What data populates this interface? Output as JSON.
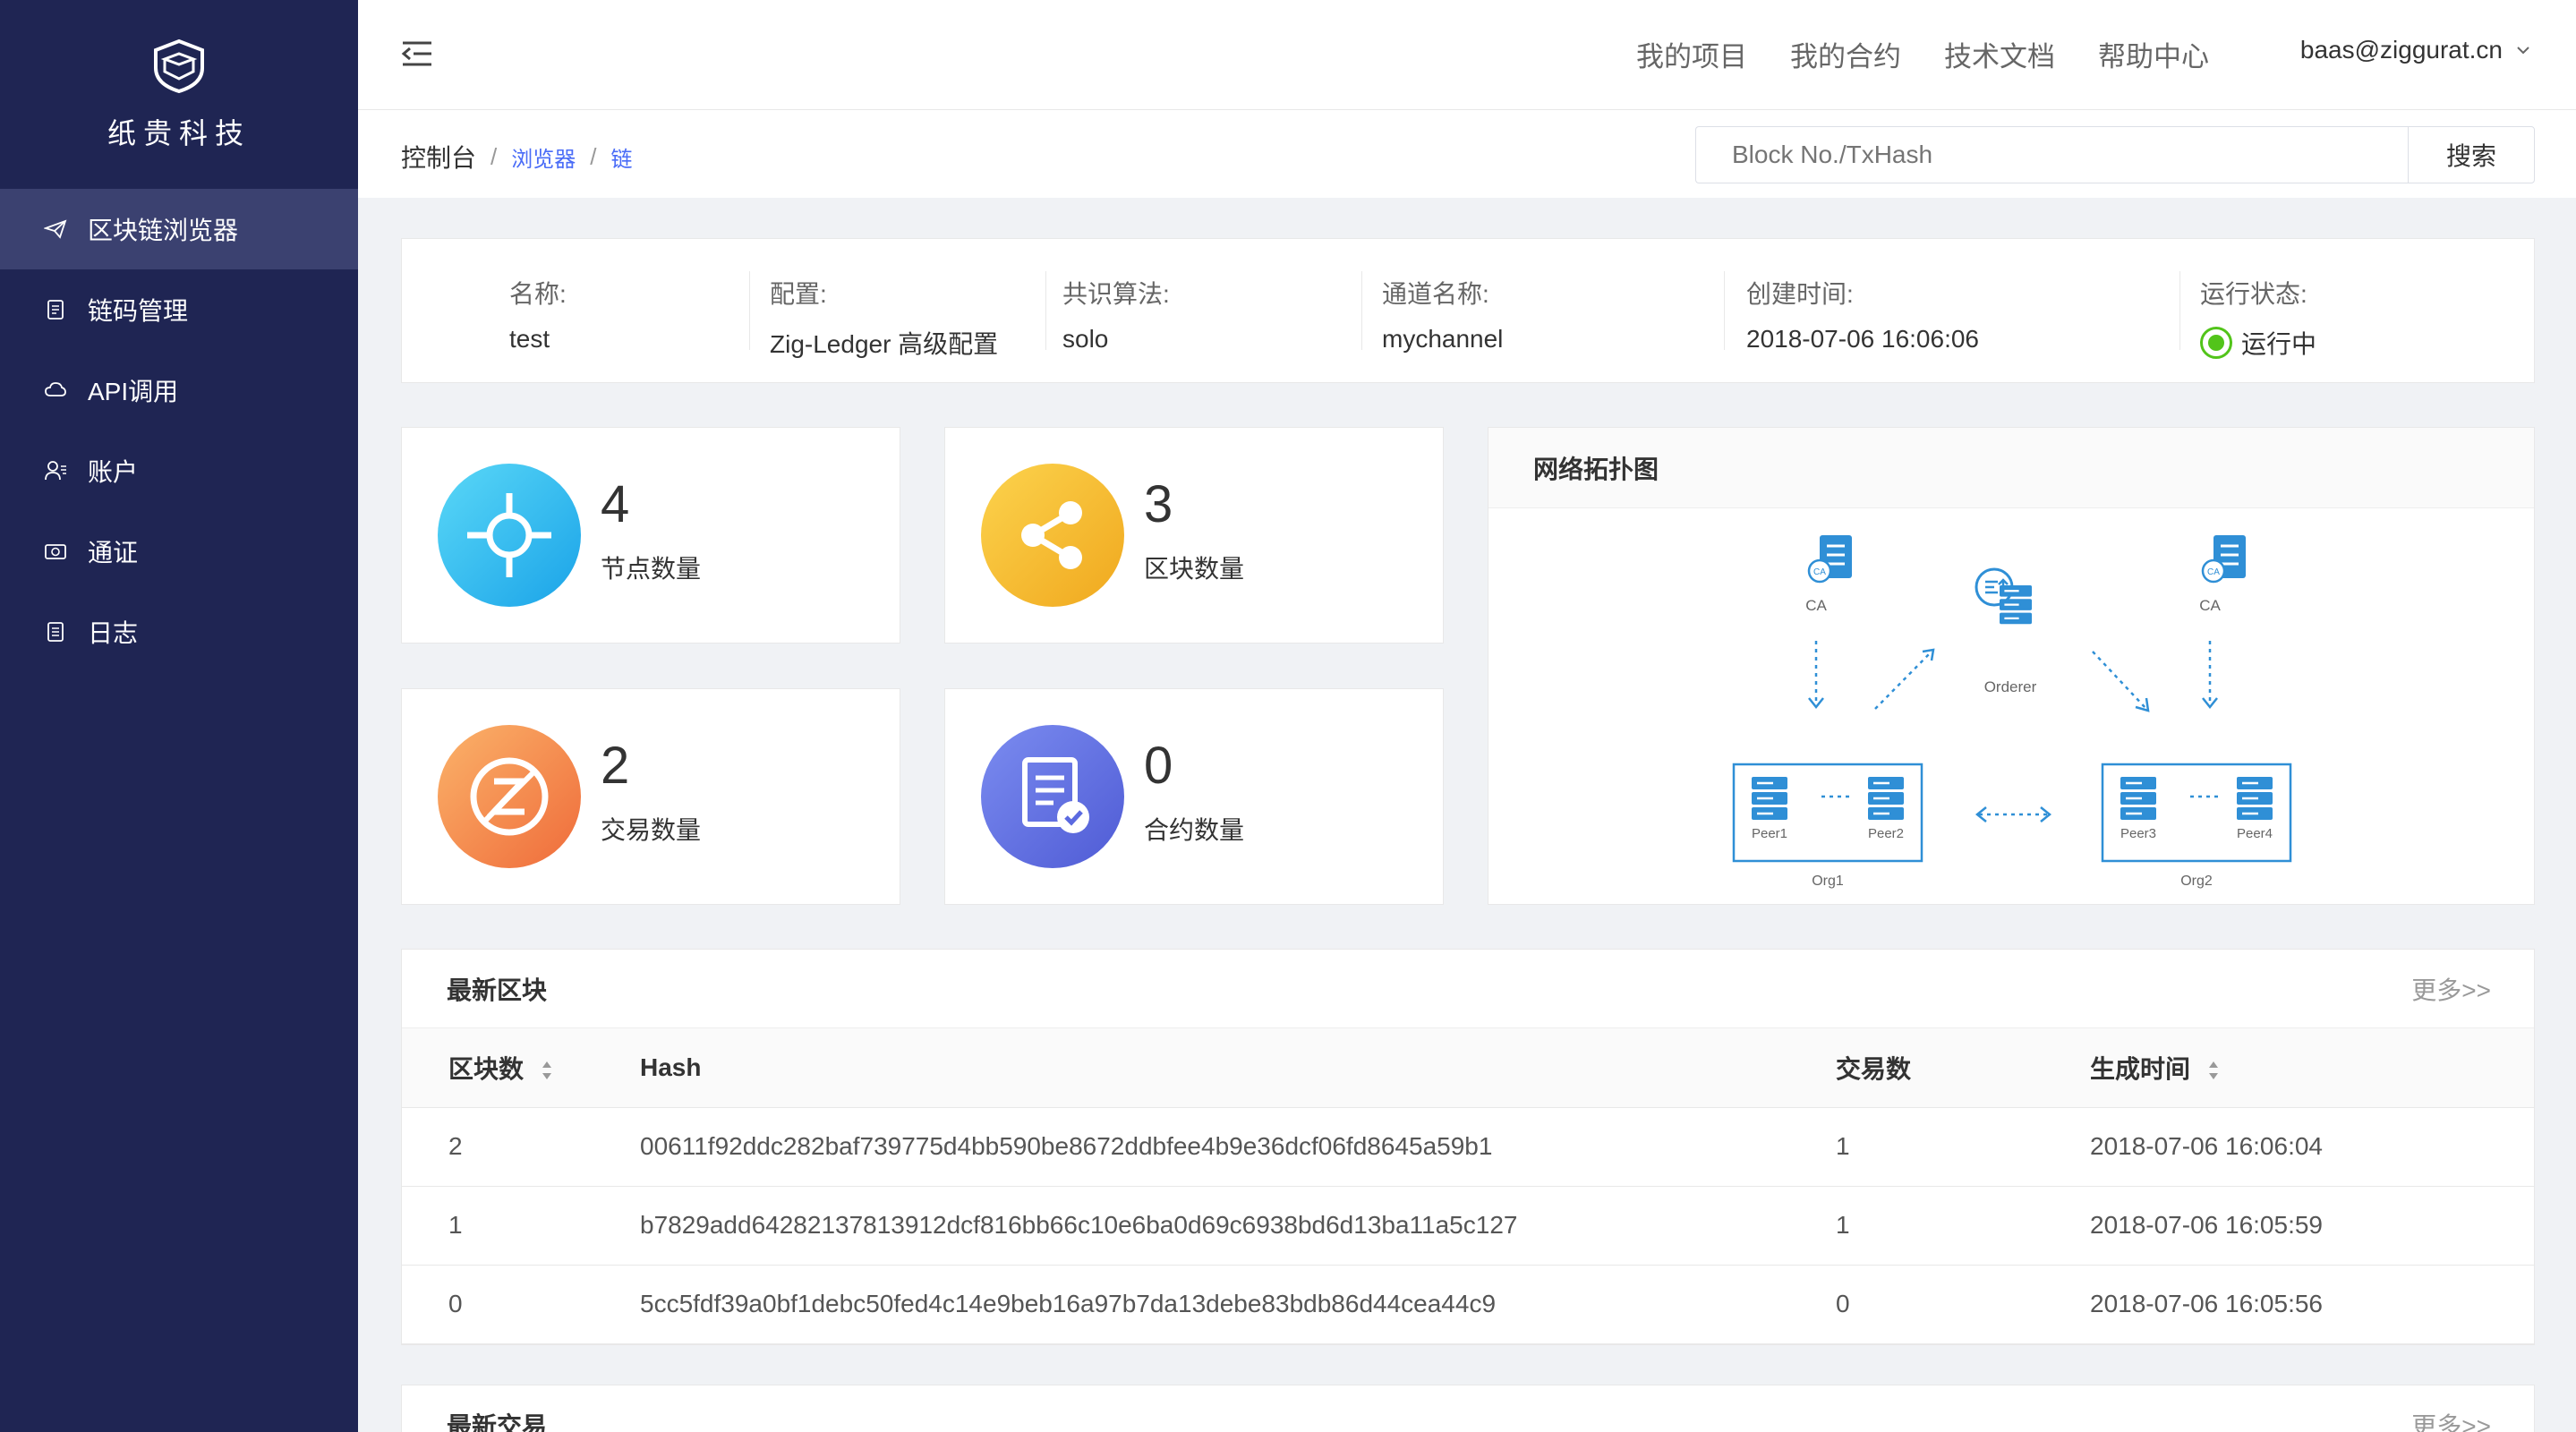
{
  "brand": {
    "name": "纸贵科技"
  },
  "sidebar": {
    "items": [
      {
        "label": "区块链浏览器",
        "icon": "send-icon",
        "active": true
      },
      {
        "label": "链码管理",
        "icon": "document-icon",
        "active": false
      },
      {
        "label": "API调用",
        "icon": "cloud-api-icon",
        "active": false
      },
      {
        "label": "账户",
        "icon": "user-icon",
        "active": false
      },
      {
        "label": "通证",
        "icon": "token-icon",
        "active": false
      },
      {
        "label": "日志",
        "icon": "log-icon",
        "active": false
      }
    ]
  },
  "topnav": {
    "links": [
      "我的项目",
      "我的合约",
      "技术文档",
      "帮助中心"
    ],
    "user": "baas@ziggurat.cn"
  },
  "breadcrumb": {
    "root": "控制台",
    "level1": "浏览器",
    "level2": "链"
  },
  "search": {
    "placeholder": "Block No./TxHash",
    "button": "搜索"
  },
  "info": {
    "name_label": "名称:",
    "name": "test",
    "config_label": "配置:",
    "config": "Zig-Ledger 高级配置",
    "consensus_label": "共识算法:",
    "consensus": "solo",
    "channel_label": "通道名称:",
    "channel": "mychannel",
    "created_label": "创建时间:",
    "created": "2018-07-06 16:06:06",
    "status_label": "运行状态:",
    "status": "运行中",
    "status_color": "#52c41a"
  },
  "stats": {
    "nodes": {
      "value": "4",
      "label": "节点数量"
    },
    "blocks": {
      "value": "3",
      "label": "区块数量"
    },
    "transactions": {
      "value": "2",
      "label": "交易数量"
    },
    "contracts": {
      "value": "0",
      "label": "合约数量"
    }
  },
  "topology": {
    "title": "网络拓扑图",
    "ca": "CA",
    "orderer": "Orderer",
    "peers": [
      "Peer1",
      "Peer2",
      "Peer3",
      "Peer4"
    ],
    "orgs": [
      "Org1",
      "Org2"
    ]
  },
  "blocks_table": {
    "title": "最新区块",
    "more": "更多>>",
    "columns": [
      "区块数",
      "Hash",
      "交易数",
      "生成时间"
    ],
    "rows": [
      {
        "number": "2",
        "hash": "00611f92ddc282baf739775d4bb590be8672ddbfee4b9e36dcf06fd8645a59b1",
        "tx": "1",
        "time": "2018-07-06 16:06:04"
      },
      {
        "number": "1",
        "hash": "b7829add64282137813912dcf816bb66c10e6ba0d69c6938bd6d13ba11a5c127",
        "tx": "1",
        "time": "2018-07-06 16:05:59"
      },
      {
        "number": "0",
        "hash": "5cc5fdf39a0bf1debc50fed4c14e9beb16a97b7da13debe83bdb86d44cea44c9",
        "tx": "0",
        "time": "2018-07-06 16:05:56"
      }
    ]
  },
  "tx_panel": {
    "title": "最新交易",
    "more": "更多>>"
  },
  "colors": {
    "sidebar_bg": "#1f2553",
    "sidebar_active": "#3b4170",
    "accent": "#4a6cf7",
    "nodes_gradient": [
      "#5ad8f7",
      "#1aa3e8"
    ],
    "blocks_gradient": [
      "#fcd34d",
      "#f0a81e"
    ],
    "tx_gradient": [
      "#fbb36a",
      "#ef6b3a"
    ],
    "contracts_gradient": [
      "#7b8cf0",
      "#4f5bd5"
    ]
  }
}
